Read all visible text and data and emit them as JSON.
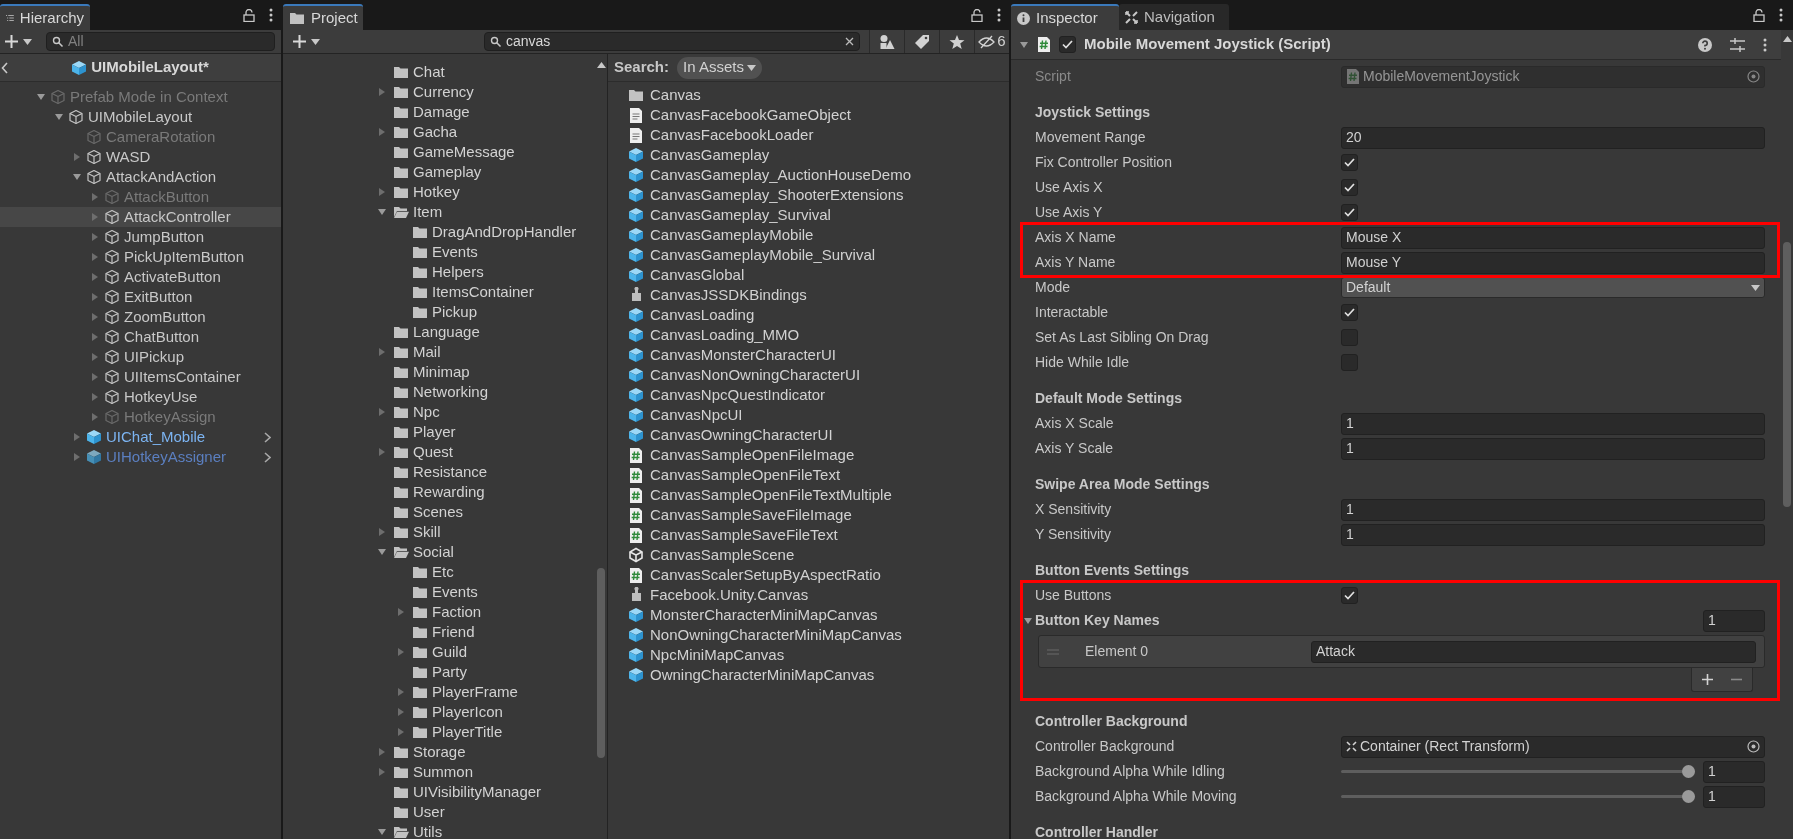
{
  "hierarchy": {
    "tab": {
      "label": "Hierarchy",
      "selected": true
    },
    "search": {
      "placeholder": "All"
    },
    "breadcrumb": "UIMobileLayout*",
    "nodes": [
      {
        "label": "Prefab Mode in Context",
        "kind": "object",
        "disabled": true,
        "selected": false,
        "expanded": true,
        "children": [
          {
            "label": "UIMobileLayout",
            "kind": "object",
            "disabled": false,
            "selected": false,
            "expanded": true,
            "children": [
              {
                "label": "CameraRotation",
                "kind": "object",
                "disabled": true,
                "selected": false
              },
              {
                "label": "WASD",
                "kind": "object",
                "disabled": false,
                "selected": false,
                "expanded": false
              },
              {
                "label": "AttackAndAction",
                "kind": "object",
                "disabled": false,
                "selected": false,
                "expanded": true,
                "children": [
                  {
                    "label": "AttackButton",
                    "kind": "object",
                    "disabled": true,
                    "selected": false,
                    "expanded": false
                  },
                  {
                    "label": "AttackController",
                    "kind": "object",
                    "disabled": false,
                    "selected": true,
                    "expanded": false
                  },
                  {
                    "label": "JumpButton",
                    "kind": "object",
                    "disabled": false,
                    "selected": false,
                    "expanded": false
                  },
                  {
                    "label": "PickUpItemButton",
                    "kind": "object",
                    "disabled": false,
                    "selected": false,
                    "expanded": false
                  },
                  {
                    "label": "ActivateButton",
                    "kind": "object",
                    "disabled": false,
                    "selected": false,
                    "expanded": false
                  },
                  {
                    "label": "ExitButton",
                    "kind": "object",
                    "disabled": false,
                    "selected": false,
                    "expanded": false
                  },
                  {
                    "label": "ZoomButton",
                    "kind": "object",
                    "disabled": false,
                    "selected": false,
                    "expanded": false
                  },
                  {
                    "label": "ChatButton",
                    "kind": "object",
                    "disabled": false,
                    "selected": false,
                    "expanded": false
                  },
                  {
                    "label": "UIPickup",
                    "kind": "object",
                    "disabled": false,
                    "selected": false,
                    "expanded": false
                  },
                  {
                    "label": "UIItemsContainer",
                    "kind": "object",
                    "disabled": false,
                    "selected": false,
                    "expanded": false
                  },
                  {
                    "label": "HotkeyUse",
                    "kind": "object",
                    "disabled": false,
                    "selected": false,
                    "expanded": false
                  },
                  {
                    "label": "HotkeyAssign",
                    "kind": "object",
                    "disabled": true,
                    "selected": false,
                    "expanded": false
                  }
                ]
              },
              {
                "label": "UIChat_Mobile",
                "kind": "prefab",
                "disabled": false,
                "selected": false,
                "expanded": false
              },
              {
                "label": "UIHotkeyAssigner",
                "kind": "prefab",
                "disabled": true,
                "selected": false,
                "expanded": false
              }
            ]
          }
        ]
      }
    ]
  },
  "project": {
    "tab": {
      "label": "Project",
      "selected": true
    },
    "search": {
      "value": "canvas"
    },
    "hidden_count": "6",
    "scope_label": "Search:",
    "scope": "In Assets",
    "folders": [
      {
        "label": "Chat",
        "selected": false
      },
      {
        "label": "Currency",
        "selected": false,
        "expanded": false
      },
      {
        "label": "Damage",
        "selected": false
      },
      {
        "label": "Gacha",
        "selected": false,
        "expanded": false
      },
      {
        "label": "GameMessage",
        "selected": false
      },
      {
        "label": "Gameplay",
        "selected": false
      },
      {
        "label": "Hotkey",
        "selected": false,
        "expanded": false
      },
      {
        "label": "Item",
        "selected": false,
        "expanded": true,
        "children": [
          {
            "label": "DragAndDropHandler",
            "selected": false
          },
          {
            "label": "Events",
            "selected": false
          },
          {
            "label": "Helpers",
            "selected": false
          },
          {
            "label": "ItemsContainer",
            "selected": false
          },
          {
            "label": "Pickup",
            "selected": false
          }
        ]
      },
      {
        "label": "Language",
        "selected": false
      },
      {
        "label": "Mail",
        "selected": false,
        "expanded": false
      },
      {
        "label": "Minimap",
        "selected": false
      },
      {
        "label": "Networking",
        "selected": false
      },
      {
        "label": "Npc",
        "selected": false,
        "expanded": false
      },
      {
        "label": "Player",
        "selected": false
      },
      {
        "label": "Quest",
        "selected": false,
        "expanded": false
      },
      {
        "label": "Resistance",
        "selected": false
      },
      {
        "label": "Rewarding",
        "selected": false
      },
      {
        "label": "Scenes",
        "selected": false
      },
      {
        "label": "Skill",
        "selected": false,
        "expanded": false
      },
      {
        "label": "Social",
        "selected": false,
        "expanded": true,
        "children": [
          {
            "label": "Etc",
            "selected": false
          },
          {
            "label": "Events",
            "selected": false
          },
          {
            "label": "Faction",
            "selected": false,
            "expanded": false
          },
          {
            "label": "Friend",
            "selected": false
          },
          {
            "label": "Guild",
            "selected": false,
            "expanded": false
          },
          {
            "label": "Party",
            "selected": false
          },
          {
            "label": "PlayerFrame",
            "selected": false,
            "expanded": false
          },
          {
            "label": "PlayerIcon",
            "selected": false,
            "expanded": false
          },
          {
            "label": "PlayerTitle",
            "selected": false,
            "expanded": false
          }
        ]
      },
      {
        "label": "Storage",
        "selected": false,
        "expanded": false
      },
      {
        "label": "Summon",
        "selected": false,
        "expanded": false
      },
      {
        "label": "UIVisibilityManager",
        "selected": false
      },
      {
        "label": "User",
        "selected": false
      },
      {
        "label": "Utils",
        "selected": false,
        "expanded": true
      }
    ],
    "results": [
      {
        "label": "Canvas",
        "kind": "folder",
        "selected": false
      },
      {
        "label": "CanvasFacebookGameObject",
        "kind": "text",
        "selected": false
      },
      {
        "label": "CanvasFacebookLoader",
        "kind": "text",
        "selected": false
      },
      {
        "label": "CanvasGameplay",
        "kind": "prefab",
        "selected": false
      },
      {
        "label": "CanvasGameplay_AuctionHouseDemo",
        "kind": "prefab",
        "selected": false
      },
      {
        "label": "CanvasGameplay_ShooterExtensions",
        "kind": "prefab",
        "selected": false
      },
      {
        "label": "CanvasGameplay_Survival",
        "kind": "prefab",
        "selected": false
      },
      {
        "label": "CanvasGameplayMobile",
        "kind": "prefab",
        "selected": false
      },
      {
        "label": "CanvasGameplayMobile_Survival",
        "kind": "prefab",
        "selected": false
      },
      {
        "label": "CanvasGlobal",
        "kind": "prefab",
        "selected": false
      },
      {
        "label": "CanvasJSSDKBindings",
        "kind": "plugin",
        "selected": false
      },
      {
        "label": "CanvasLoading",
        "kind": "prefab",
        "selected": false
      },
      {
        "label": "CanvasLoading_MMO",
        "kind": "prefab",
        "selected": false
      },
      {
        "label": "CanvasMonsterCharacterUI",
        "kind": "prefab",
        "selected": false
      },
      {
        "label": "CanvasNonOwningCharacterUI",
        "kind": "prefab",
        "selected": false
      },
      {
        "label": "CanvasNpcQuestIndicator",
        "kind": "prefab",
        "selected": false
      },
      {
        "label": "CanvasNpcUI",
        "kind": "prefab",
        "selected": false
      },
      {
        "label": "CanvasOwningCharacterUI",
        "kind": "prefab",
        "selected": false
      },
      {
        "label": "CanvasSampleOpenFileImage",
        "kind": "script",
        "selected": false
      },
      {
        "label": "CanvasSampleOpenFileText",
        "kind": "script",
        "selected": false
      },
      {
        "label": "CanvasSampleOpenFileTextMultiple",
        "kind": "script",
        "selected": false
      },
      {
        "label": "CanvasSampleSaveFileImage",
        "kind": "script",
        "selected": false
      },
      {
        "label": "CanvasSampleSaveFileText",
        "kind": "script",
        "selected": false
      },
      {
        "label": "CanvasSampleScene",
        "kind": "scene",
        "selected": false
      },
      {
        "label": "CanvasScalerSetupByAspectRatio",
        "kind": "script",
        "selected": false
      },
      {
        "label": "Facebook.Unity.Canvas",
        "kind": "plugin",
        "selected": false
      },
      {
        "label": "MonsterCharacterMiniMapCanvas",
        "kind": "prefab",
        "selected": false
      },
      {
        "label": "NonOwningCharacterMiniMapCanvas",
        "kind": "prefab",
        "selected": false
      },
      {
        "label": "NpcMiniMapCanvas",
        "kind": "prefab",
        "selected": false
      },
      {
        "label": "OwningCharacterMiniMapCanvas",
        "kind": "prefab",
        "selected": false
      }
    ]
  },
  "inspector": {
    "tabs": [
      {
        "label": "Inspector",
        "selected": true
      },
      {
        "label": "Navigation",
        "selected": false
      }
    ],
    "component": {
      "title": "Mobile Movement Joystick (Script)",
      "enabled": true,
      "expanded": true
    },
    "blocks": [
      {
        "highlighted": false,
        "rows": [
          {
            "kind": "script",
            "label": "Script",
            "value": "MobileMovementJoystick"
          },
          {
            "kind": "heading",
            "label": "Joystick Settings"
          },
          {
            "kind": "text",
            "label": "Movement Range",
            "value": "20"
          },
          {
            "kind": "checkbox",
            "label": "Fix Controller Position",
            "checked": true
          },
          {
            "kind": "checkbox",
            "label": "Use Axis X",
            "checked": true
          },
          {
            "kind": "checkbox",
            "label": "Use Axis Y",
            "checked": true
          }
        ]
      },
      {
        "highlighted": true,
        "rows": [
          {
            "kind": "text",
            "label": "Axis X Name",
            "value": "Mouse X"
          },
          {
            "kind": "text",
            "label": "Axis Y Name",
            "value": "Mouse Y"
          }
        ]
      },
      {
        "highlighted": false,
        "rows": [
          {
            "kind": "dropdown",
            "label": "Mode",
            "value": "Default"
          },
          {
            "kind": "checkbox",
            "label": "Interactable",
            "checked": true
          },
          {
            "kind": "checkbox",
            "label": "Set As Last Sibling On Drag",
            "checked": false
          },
          {
            "kind": "checkbox",
            "label": "Hide While Idle",
            "checked": false
          },
          {
            "kind": "heading",
            "label": "Default Mode Settings"
          },
          {
            "kind": "text",
            "label": "Axis X Scale",
            "value": "1"
          },
          {
            "kind": "text",
            "label": "Axis Y Scale",
            "value": "1"
          },
          {
            "kind": "heading",
            "label": "Swipe Area Mode Settings"
          },
          {
            "kind": "text",
            "label": "X Sensitivity",
            "value": "1"
          },
          {
            "kind": "text",
            "label": "Y Sensitivity",
            "value": "1"
          },
          {
            "kind": "heading",
            "label": "Button Events Settings"
          }
        ]
      },
      {
        "highlighted": true,
        "rows": [
          {
            "kind": "checkbox",
            "label": "Use Buttons",
            "checked": true
          },
          {
            "kind": "list",
            "label": "Button Key Names",
            "expanded": true,
            "count": "1",
            "items": [
              {
                "label": "Element 0",
                "value": "Attack"
              }
            ]
          }
        ]
      },
      {
        "highlighted": false,
        "rows": [
          {
            "kind": "heading",
            "label": "Controller Background"
          },
          {
            "kind": "object",
            "label": "Controller Background",
            "value": "Container (Rect Transform)"
          },
          {
            "kind": "slider",
            "label": "Background Alpha While Idling",
            "level": 1,
            "value": "1"
          },
          {
            "kind": "slider",
            "label": "Background Alpha While Moving",
            "level": 1,
            "value": "1"
          },
          {
            "kind": "heading",
            "label": "Controller Handler"
          }
        ]
      }
    ]
  }
}
